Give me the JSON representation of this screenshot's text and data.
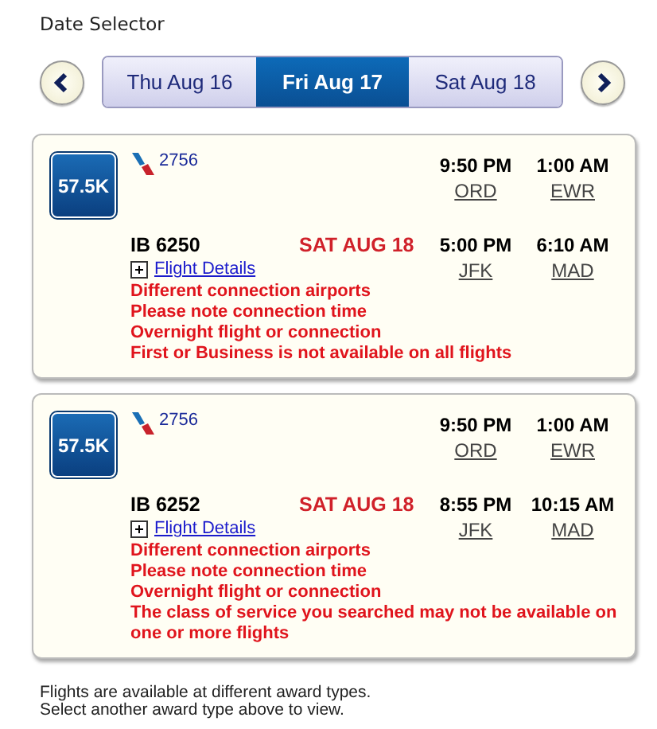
{
  "title": "Date Selector",
  "tabs": [
    {
      "label": "Thu Aug 16",
      "selected": false
    },
    {
      "label": "Fri Aug 17",
      "selected": true
    },
    {
      "label": "Sat Aug 18",
      "selected": false
    }
  ],
  "results": [
    {
      "price": "57.5K",
      "segments": [
        {
          "kind": "logo",
          "flight": "2756",
          "dep_time": "9:50 PM",
          "dep_airport": "ORD",
          "arr_time": "1:00 AM",
          "arr_airport": "EWR"
        },
        {
          "kind": "code",
          "flight": "IB 6250",
          "date": "SAT AUG 18",
          "dep_time": "5:00 PM",
          "dep_airport": "JFK",
          "arr_time": "6:10 AM",
          "arr_airport": "MAD"
        }
      ],
      "details_link": "Flight Details",
      "expanded": false,
      "warnings": [
        "Different connection airports",
        "Please note connection time",
        "Overnight flight or connection",
        "First or Business is not available on all flights"
      ]
    },
    {
      "price": "57.5K",
      "segments": [
        {
          "kind": "logo",
          "flight": "2756",
          "dep_time": "9:50 PM",
          "dep_airport": "ORD",
          "arr_time": "1:00 AM",
          "arr_airport": "EWR"
        },
        {
          "kind": "code",
          "flight": "IB 6252",
          "date": "SAT AUG 18",
          "dep_time": "8:55 PM",
          "dep_airport": "JFK",
          "arr_time": "10:15 AM",
          "arr_airport": "MAD"
        }
      ],
      "details_link": "Flight Details",
      "expanded": false,
      "warnings": [
        "Different connection airports",
        "Please note connection time",
        "Overnight flight or connection",
        "The class of service you searched may not be available on one or more flights"
      ]
    }
  ],
  "notes": [
    "Flights are available at different award types.",
    "Select another award type above to view."
  ]
}
